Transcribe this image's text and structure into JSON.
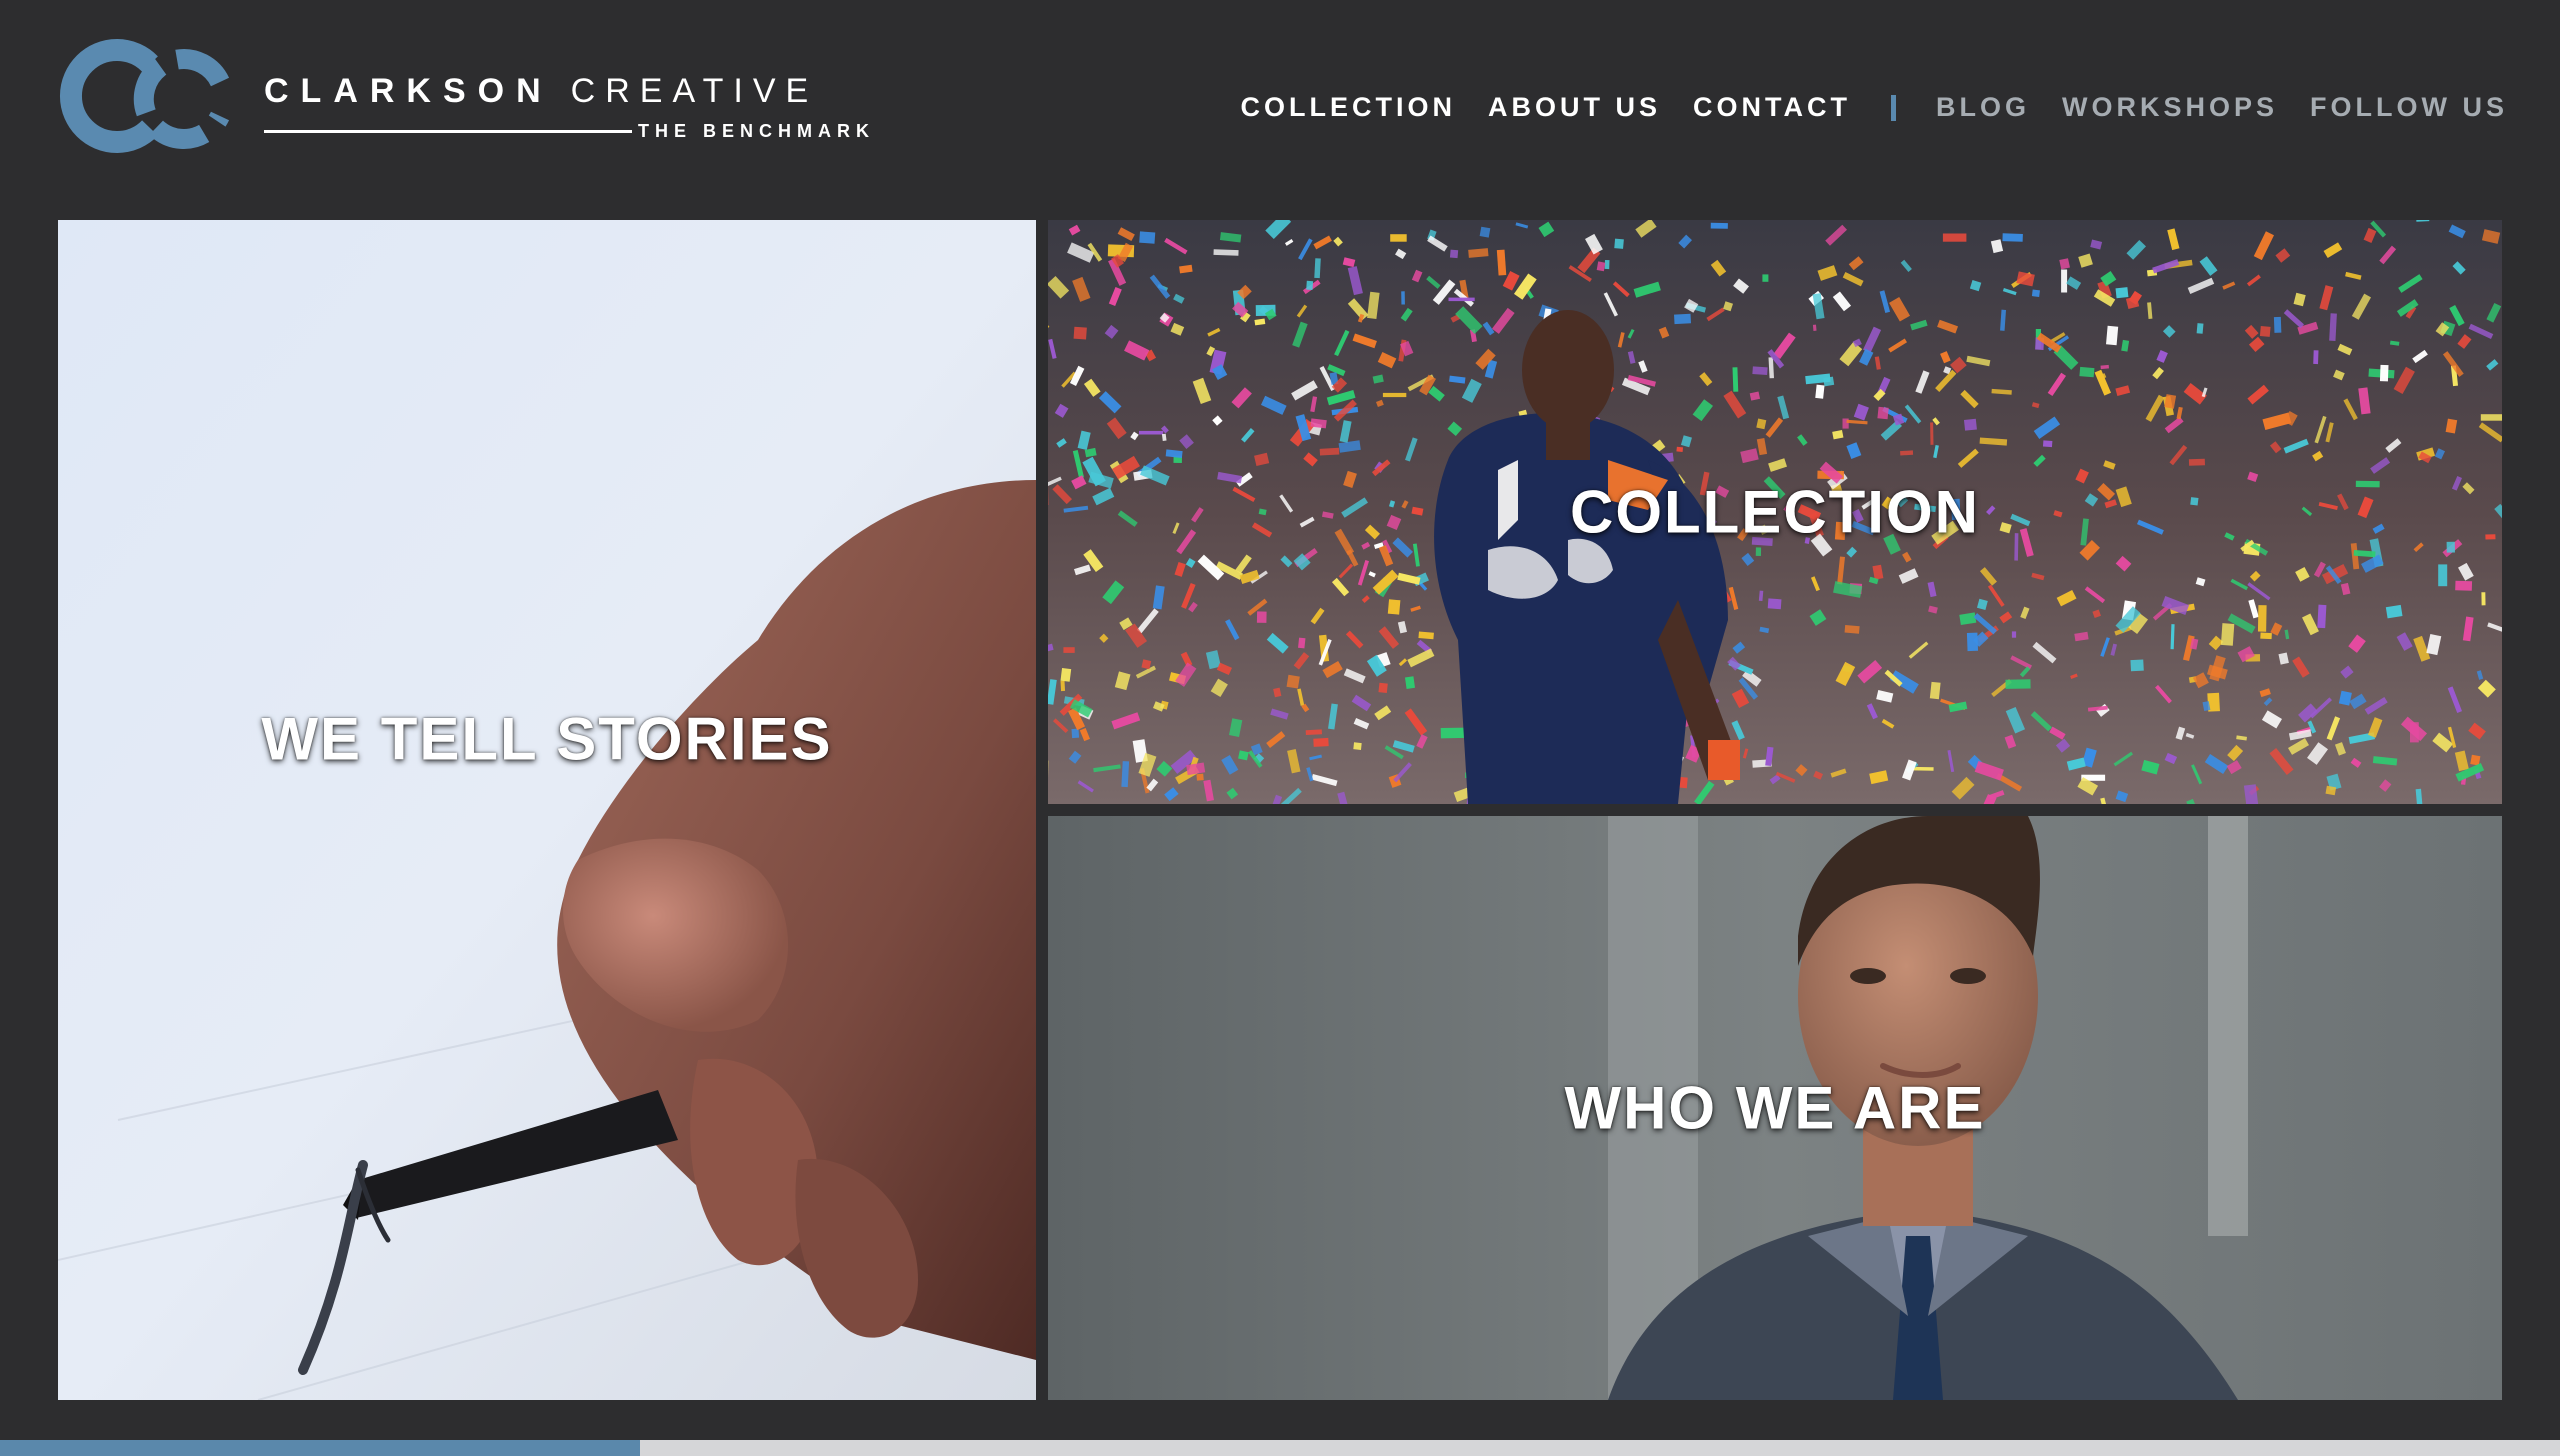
{
  "brand": {
    "name_strong": "CLARKSON",
    "name_light": "CREATIVE",
    "tagline": "THE BENCHMARK",
    "accent_color": "#5a8ab0"
  },
  "nav": {
    "primary": [
      "COLLECTION",
      "ABOUT US",
      "CONTACT"
    ],
    "separator": "|",
    "secondary": [
      "BLOG",
      "WORKSHOPS",
      "FOLLOW US"
    ]
  },
  "tiles": {
    "stories": {
      "label": "WE TELL STORIES"
    },
    "collection": {
      "label": "COLLECTION"
    },
    "who": {
      "label": "WHO WE ARE"
    }
  },
  "progress": {
    "fraction": 0.25,
    "fill_color": "#5a88ab",
    "track_color": "#d5d6d8"
  }
}
